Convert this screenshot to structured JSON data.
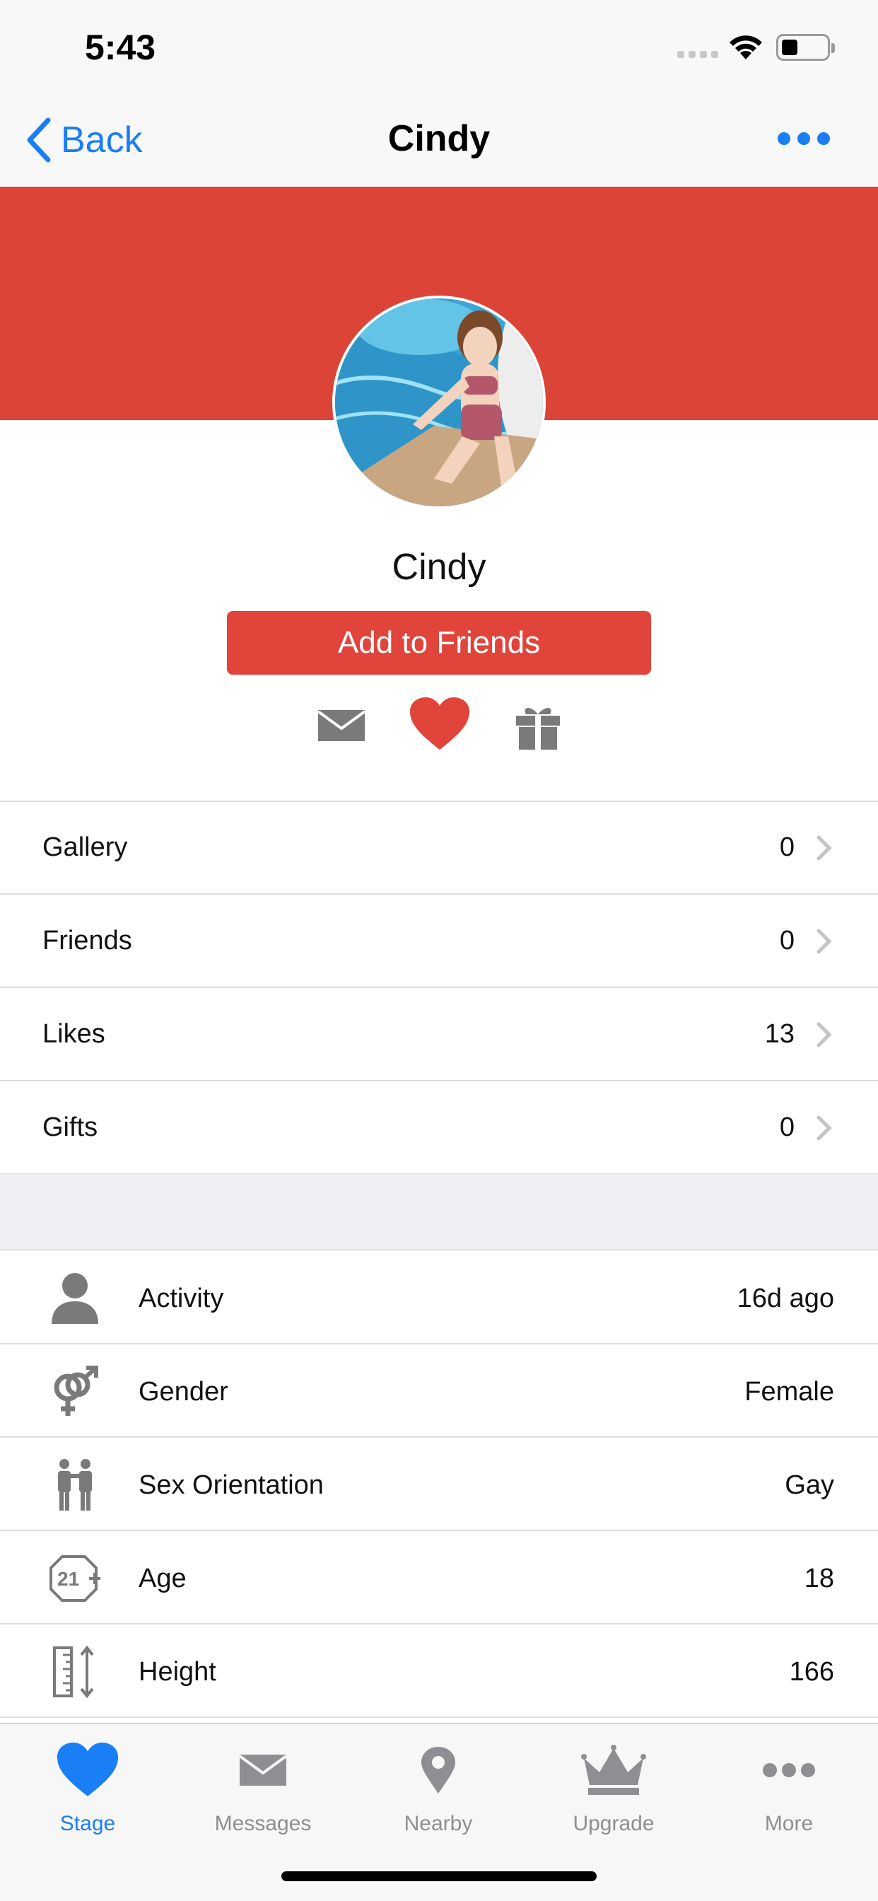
{
  "status_bar": {
    "time": "5:43"
  },
  "nav": {
    "back_label": "Back",
    "title": "Cindy"
  },
  "profile": {
    "name": "Cindy",
    "add_button": "Add to Friends"
  },
  "counts": [
    {
      "label": "Gallery",
      "value": "0"
    },
    {
      "label": "Friends",
      "value": "0"
    },
    {
      "label": "Likes",
      "value": "13"
    },
    {
      "label": "Gifts",
      "value": "0"
    }
  ],
  "details": [
    {
      "label": "Activity",
      "value": "16d ago",
      "icon": "person-icon"
    },
    {
      "label": "Gender",
      "value": "Female",
      "icon": "gender-symbol-icon"
    },
    {
      "label": "Sex Orientation",
      "value": "Gay",
      "icon": "couple-icon"
    },
    {
      "label": "Age",
      "value": "18",
      "icon": "age-21-plus-icon"
    },
    {
      "label": "Height",
      "value": "166",
      "icon": "ruler-height-icon"
    }
  ],
  "tabs": [
    {
      "label": "Stage",
      "icon": "heart-icon",
      "active": true
    },
    {
      "label": "Messages",
      "icon": "envelope-icon"
    },
    {
      "label": "Nearby",
      "icon": "location-pin-icon"
    },
    {
      "label": "Upgrade",
      "icon": "crown-icon"
    },
    {
      "label": "More",
      "icon": "more-dots-icon"
    }
  ],
  "colors": {
    "accent": "#1a7ef5",
    "brand_red": "#db4437",
    "button_red": "#e0443a",
    "icon_gray": "#7a7a7a"
  }
}
